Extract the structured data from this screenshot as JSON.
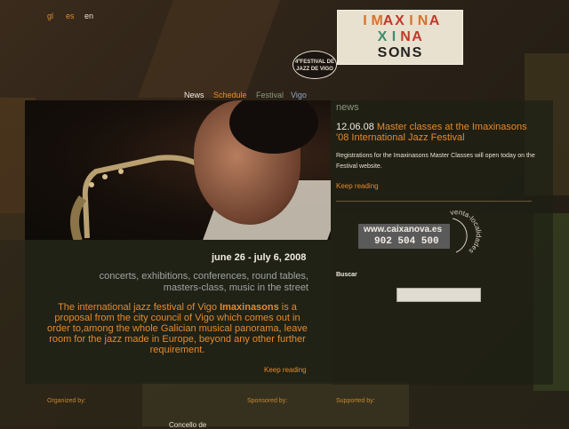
{
  "languages": [
    "gl",
    "es",
    "en"
  ],
  "logo": {
    "rows": [
      {
        "letters": [
          "I",
          "M",
          "A",
          "X",
          "I",
          "N",
          "A"
        ],
        "colors": [
          "#d8722a",
          "#d8722a",
          "#c0392b",
          "#c0392b",
          "#d8722a",
          "#d8722a",
          "#c0392b"
        ]
      },
      {
        "letters": [
          "X",
          "I",
          "N",
          "A"
        ],
        "colors": [
          "#3e8e6e",
          "#3e8e6e",
          "#c0392b",
          "#c0392b"
        ]
      },
      {
        "letters": [
          "S",
          "O",
          "N",
          "S"
        ],
        "colors": [
          "#222222",
          "#222222",
          "#222222",
          "#222222"
        ]
      }
    ],
    "display": [
      "IMAXINA",
      "XINA",
      "SONS"
    ]
  },
  "badge": {
    "line1": "4ºFESTIVAL DE",
    "line2": "JAZZ DE VIGO"
  },
  "nav": {
    "news": "News",
    "schedule": "Schedule",
    "festival": "Festival",
    "vigo": "Vigo"
  },
  "main": {
    "dates": "june 26 - july 6, 2008",
    "tagline": "concerts, exhibitions, conferences, round tables, masters-class, music in the street",
    "intro_before": "The international jazz festival of Vigo ",
    "intro_bold": "Imaxinasons",
    "intro_after": " is a proposal from the city council of Vigo which comes out in order to,among the whole Galician musical panorama, leave room for the jazz made in Europe, beyond any other further requirement.",
    "keep_reading": "Keep reading"
  },
  "news": {
    "heading": "news",
    "date": "12.06.08",
    "title": "Master classes at the Imaxinasons '08 International Jazz Festival",
    "body": "Registrations for the Imaxinasons Master Classes will open today on the Festival website.",
    "keep_reading": "Keep reading"
  },
  "caixanova": {
    "url": "www.caixanova.es",
    "phone": "902 504 500",
    "venta": "venta-localidades"
  },
  "search": {
    "label": "Buscar",
    "value": ""
  },
  "footer": {
    "organized": "Organized by:",
    "sponsored": "Sponsored by:",
    "supported": "Supported by:",
    "bit": "Concello de"
  },
  "colors": {
    "accent": "#e58a2c",
    "text_light": "#f0ece2",
    "festival_green": "#8a9a7c",
    "vigo_blue": "#8fa7c9"
  }
}
